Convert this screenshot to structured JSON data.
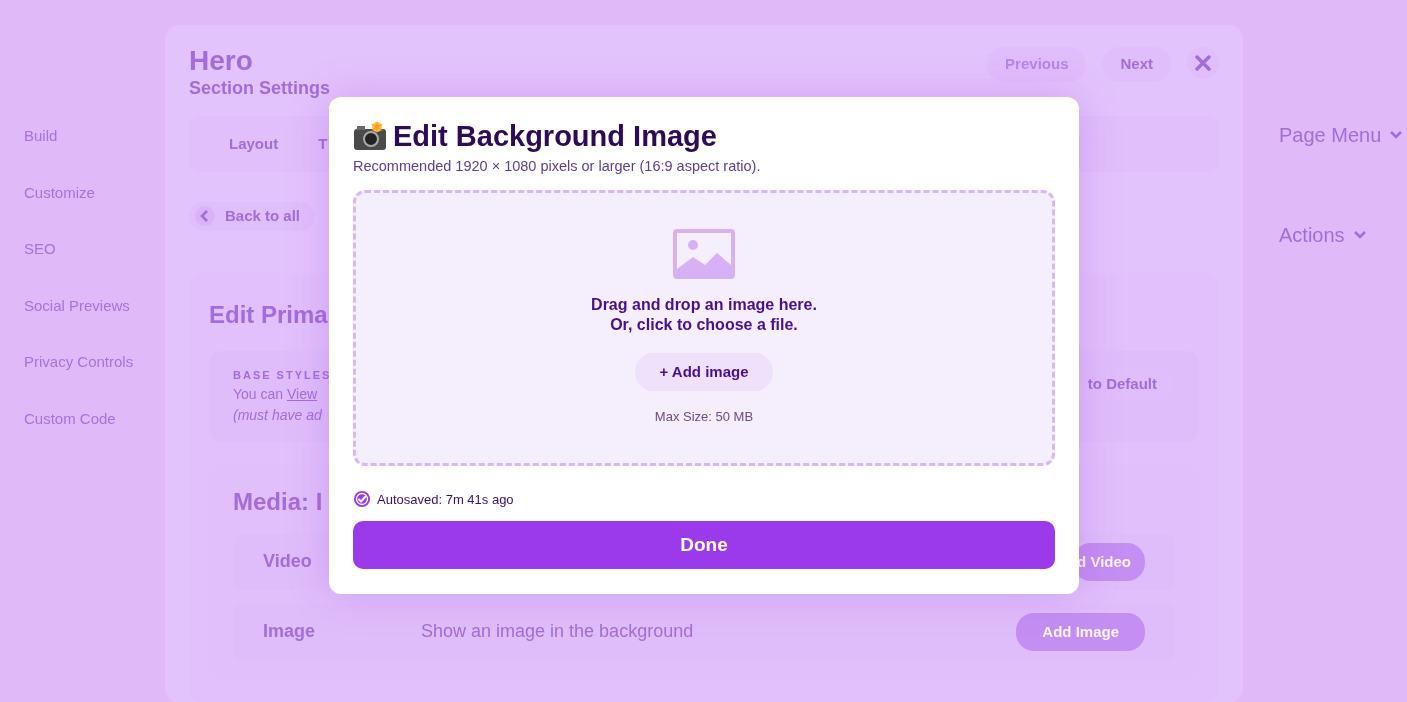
{
  "sidebar": {
    "items": [
      {
        "label": "Build"
      },
      {
        "label": "Customize"
      },
      {
        "label": "SEO"
      },
      {
        "label": "Social Previews"
      },
      {
        "label": "Privacy Controls"
      },
      {
        "label": "Custom Code"
      }
    ]
  },
  "panel": {
    "title": "Hero",
    "subtitle": "Section Settings",
    "nav_buttons": [
      {
        "label": "Previous",
        "disabled": true
      },
      {
        "label": "Next",
        "disabled": false
      }
    ],
    "tabs": [
      {
        "label": "Layout"
      },
      {
        "label": "T"
      }
    ],
    "back_button": "Back to all",
    "card": {
      "title": "Edit Prima",
      "base_styles": {
        "heading": "BASE STYLES",
        "text": "You can",
        "link": "View",
        "note": "(must have ad",
        "button": "to Default"
      },
      "media": {
        "title": "Media: I",
        "rows": [
          {
            "label": "Video",
            "button": "d Video"
          },
          {
            "label": "Image",
            "description": "Show an image in the background",
            "button": "Add Image"
          }
        ]
      }
    }
  },
  "right_column": {
    "menus": [
      "Page Menu",
      "Actions"
    ]
  },
  "modal": {
    "title": "Edit Background Image",
    "subtitle": "Recommended 1920 × 1080 pixels or larger (16:9 aspect ratio).",
    "dropzone": {
      "lines": [
        "Drag and drop an image here.",
        "Or, click to choose a file."
      ],
      "button": "+ Add image",
      "note": "Max Size: 50 MB"
    },
    "autosave": "Autosaved: 7m 41s ago",
    "done_button": "Done"
  }
}
